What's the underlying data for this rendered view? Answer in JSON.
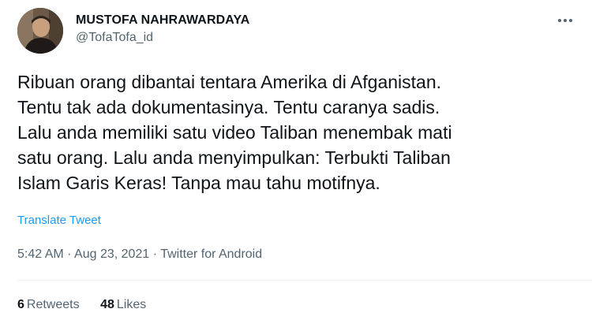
{
  "author": {
    "display_name": "MUSTOFA NAHRAWARDAYA",
    "handle": "@TofaTofa_id",
    "avatar_icon": "user-avatar"
  },
  "more_icon": "more-horizontal-icon",
  "tweet": {
    "text": "Ribuan orang dibantai tentara Amerika di Afganistan.\nTentu tak ada dokumentasinya. Tentu caranya sadis.\nLalu anda memiliki satu video Taliban menembak mati\nsatu orang. Lalu anda menyimpulkan: Terbukti Taliban\nIslam Garis Keras! Tanpa mau tahu motifnya.",
    "translate_label": "Translate Tweet"
  },
  "meta": {
    "time": "5:42 AM",
    "separator": " · ",
    "date": "Aug 23, 2021",
    "source": "Twitter for Android"
  },
  "stats": {
    "retweets_count": "6",
    "retweets_label": "Retweets",
    "likes_count": "48",
    "likes_label": "Likes"
  },
  "colors": {
    "text": "#0f1419",
    "secondary": "#536471",
    "link": "#1d9bf0"
  }
}
